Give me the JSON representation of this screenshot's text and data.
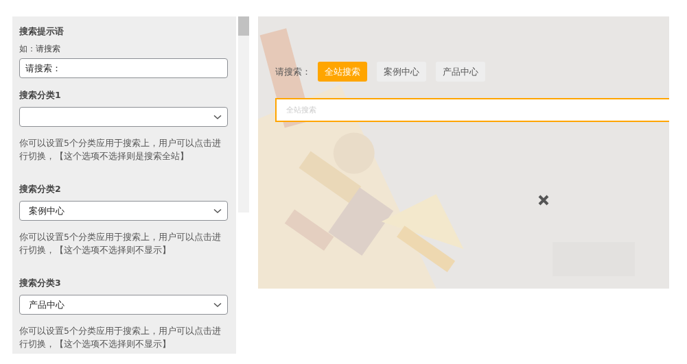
{
  "settings": {
    "title": "搜索提示语",
    "hint": "如：请搜索",
    "value": "请搜索：",
    "categories": [
      {
        "label": "搜索分类1",
        "note": "你可以设置5个分类应用于搜索上，用户可以点击进行切换，【这个选项不选择则是搜索全站】"
      },
      {
        "label": "搜索分类2",
        "value": "案例中心",
        "note": "你可以设置5个分类应用于搜索上，用户可以点击进行切换，【这个选项不选择则不显示】"
      },
      {
        "label": "搜索分类3",
        "value": "产品中心",
        "note": "你可以设置5个分类应用于搜索上，用户可以点击进行切换，【这个选项不选择则不显示】"
      }
    ]
  },
  "preview": {
    "prompt": "请搜索：",
    "tabs": [
      {
        "label": "全站搜索",
        "selected": true
      },
      {
        "label": "案例中心",
        "selected": false
      },
      {
        "label": "产品中心",
        "selected": false
      }
    ],
    "search": {
      "placeholder": "全站搜索"
    }
  }
}
